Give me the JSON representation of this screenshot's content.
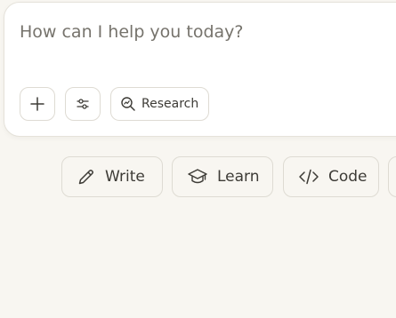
{
  "composer": {
    "placeholder": "How can I help you today?",
    "add_icon": "plus-icon",
    "tools_icon": "sliders-icon",
    "research": {
      "icon": "research-icon",
      "label": "Research"
    }
  },
  "suggestions": [
    {
      "label": "Write",
      "icon": "pencil-icon"
    },
    {
      "label": "Learn",
      "icon": "graduation-cap-icon"
    },
    {
      "label": "Code",
      "icon": "code-icon"
    }
  ]
}
